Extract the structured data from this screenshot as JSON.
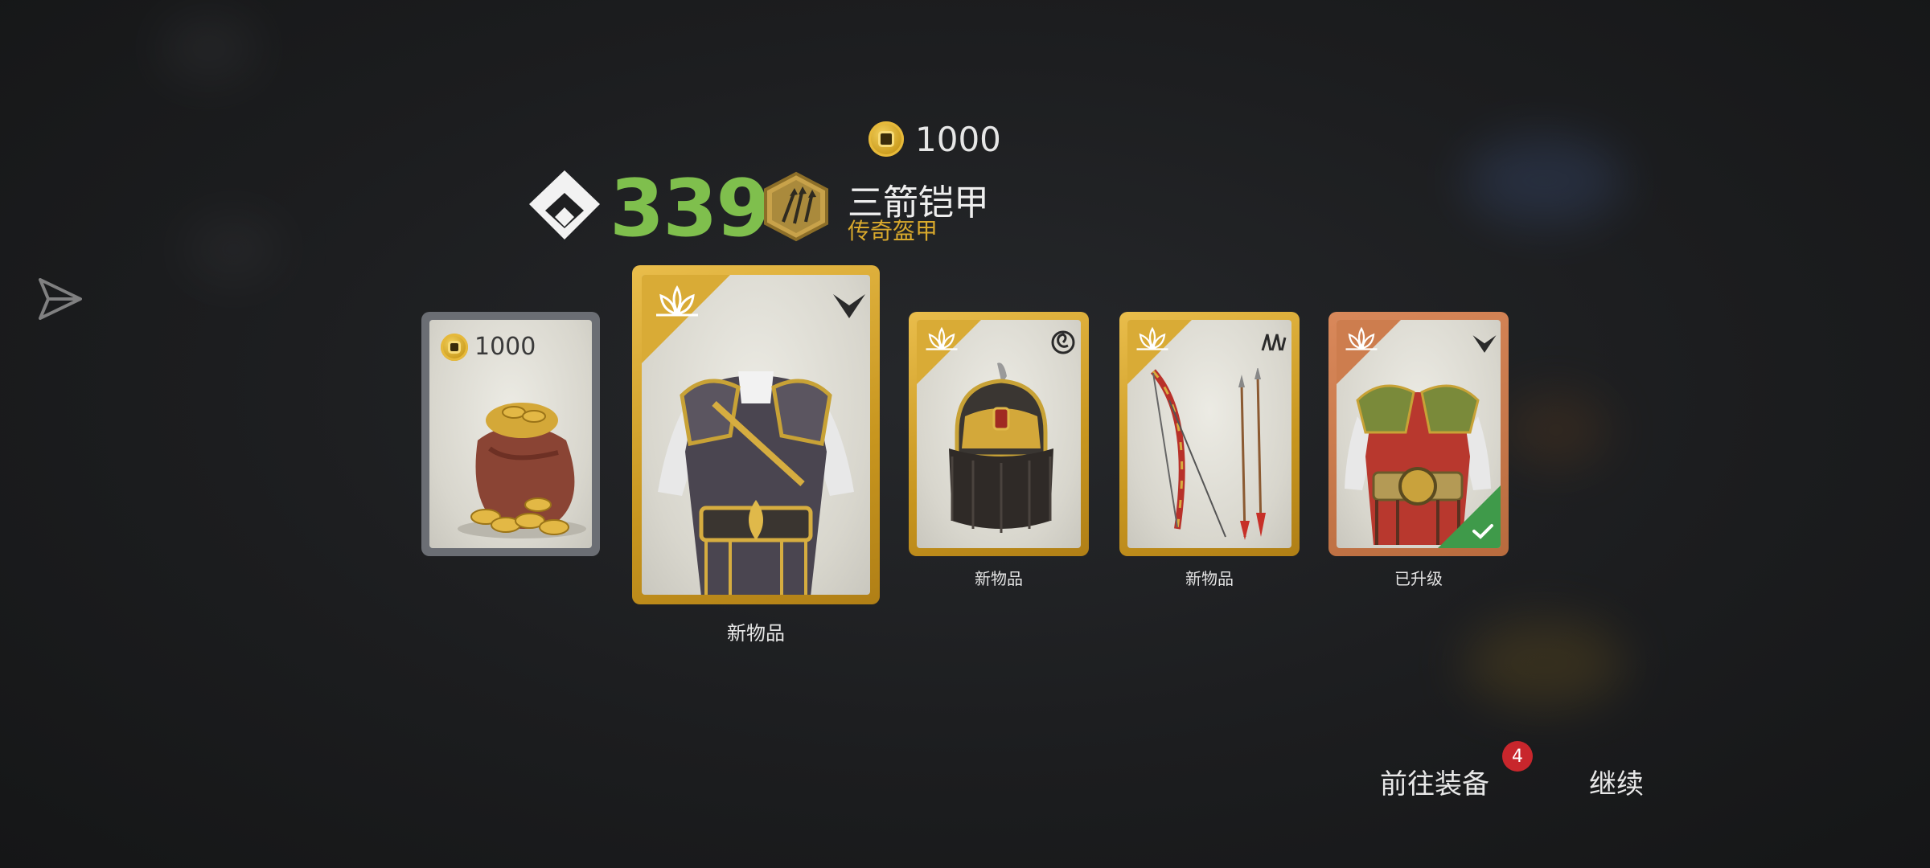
{
  "top_currency": {
    "icon": "coin-icon",
    "amount": "1000"
  },
  "header": {
    "score": "339",
    "set_name": "三箭铠甲",
    "set_rarity": "传奇盔甲",
    "colors": {
      "score": "#7fbf4d",
      "rarity": "#d9a92c"
    }
  },
  "cards": [
    {
      "type": "coin-bag",
      "frame": "grey",
      "amount": "1000",
      "label": ""
    },
    {
      "type": "chest-armor",
      "frame": "gold",
      "label": "新物品",
      "featured": true
    },
    {
      "type": "helmet",
      "frame": "gold",
      "label": "新物品"
    },
    {
      "type": "bow-and-arrows",
      "frame": "gold",
      "label": "新物品"
    },
    {
      "type": "chest-armor-red",
      "frame": "copper",
      "label": "已升级",
      "upgraded": true
    }
  ],
  "buttons": {
    "equip_label": "前往装备",
    "equip_badge": "4",
    "continue_label": "继续"
  }
}
